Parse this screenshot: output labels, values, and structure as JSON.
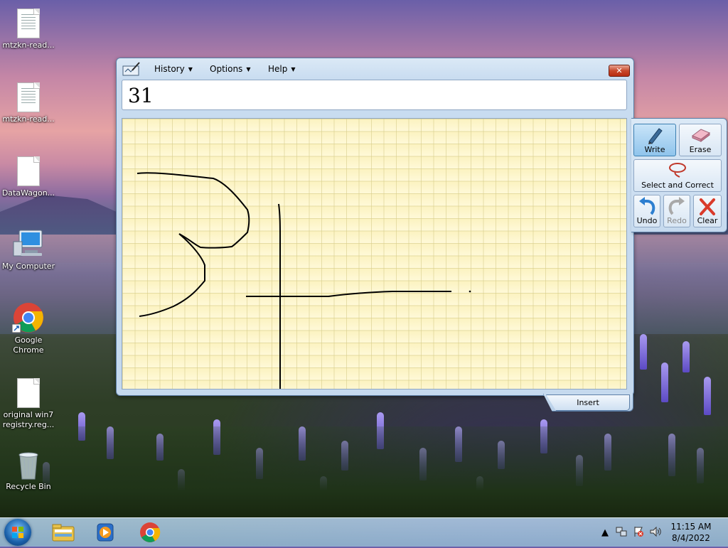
{
  "desktop": {
    "icons": [
      {
        "label": "mtzkn-read...",
        "icon": "text-document-icon"
      },
      {
        "label": "mtzkn-read...",
        "icon": "text-document-icon"
      },
      {
        "label": "DataWagon...",
        "icon": "blank-document-icon"
      },
      {
        "label": "My Computer",
        "icon": "computer-icon"
      },
      {
        "label": "Google Chrome",
        "icon": "chrome-icon"
      },
      {
        "label": "original win7 registry.reg...",
        "icon": "blank-document-icon"
      },
      {
        "label": "Recycle Bin",
        "icon": "recycle-bin-icon"
      }
    ]
  },
  "tip": {
    "menus": [
      {
        "label": "History"
      },
      {
        "label": "Options"
      },
      {
        "label": "Help"
      }
    ],
    "close_label": "✕",
    "recognized_text": "31",
    "tools": {
      "write": "Write",
      "erase": "Erase",
      "select_correct": "Select and Correct",
      "undo": "Undo",
      "redo": "Redo",
      "clear": "Clear"
    },
    "insert_label": "Insert"
  },
  "taskbar": {
    "time": "11:15 AM",
    "date": "8/4/2022",
    "pinned": [
      "windows-explorer-icon",
      "media-player-icon",
      "chrome-icon"
    ]
  }
}
